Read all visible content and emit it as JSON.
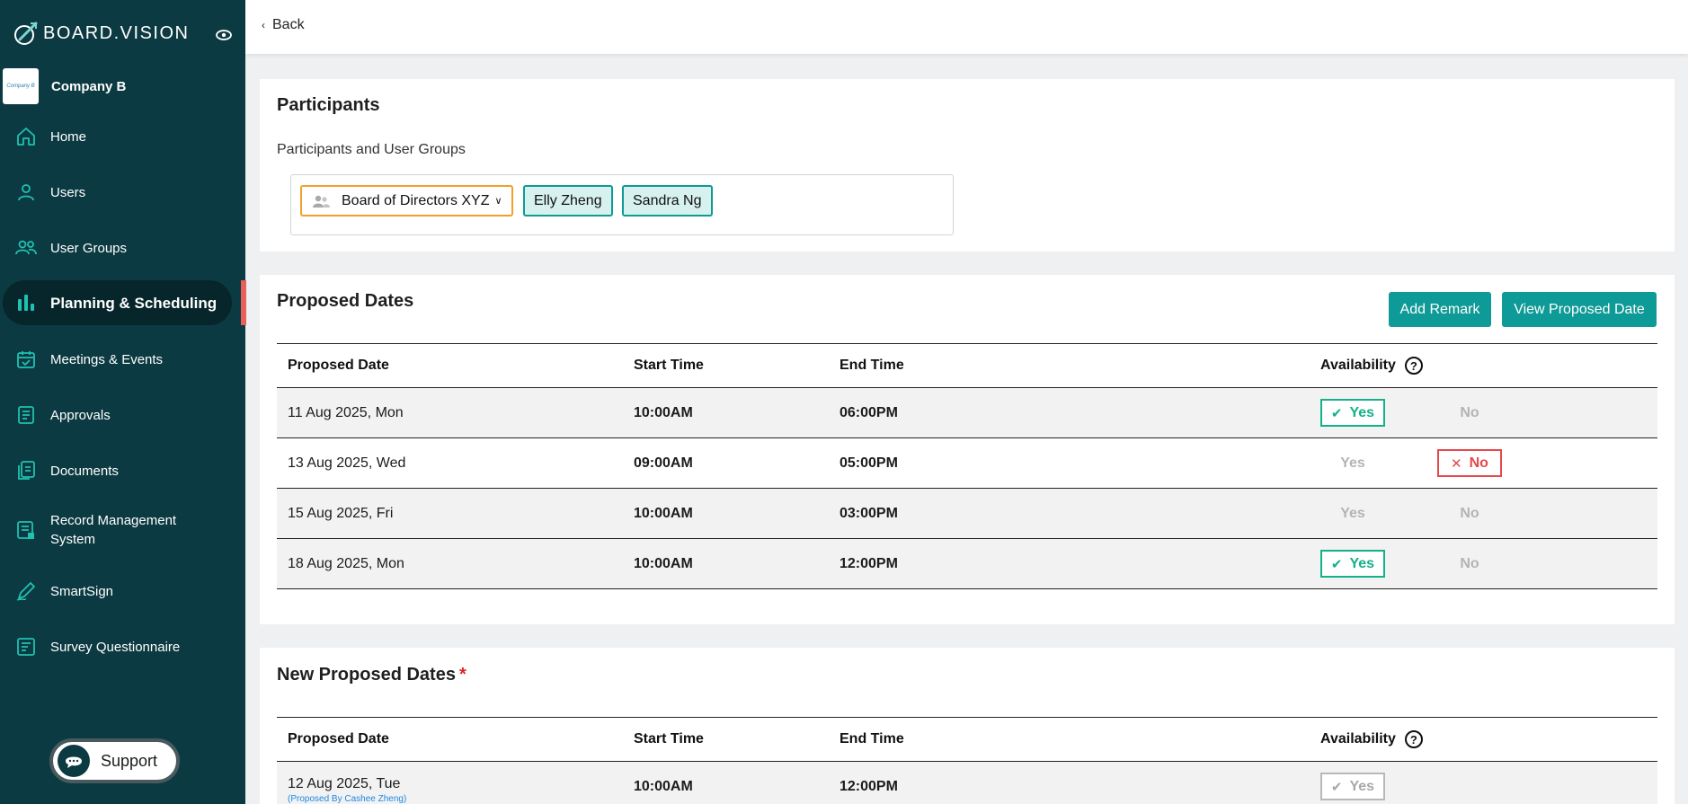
{
  "brand": {
    "name": "BOARD.VISION",
    "accent": "#0e9a96",
    "sidebar_bg": "#0c3a42"
  },
  "company": {
    "name": "Company B",
    "logo_text": "Company B"
  },
  "sidebar": {
    "items": [
      {
        "label": "Home",
        "icon": "home-icon"
      },
      {
        "label": "Users",
        "icon": "user-icon"
      },
      {
        "label": "User Groups",
        "icon": "users-icon"
      },
      {
        "label": "Planning & Scheduling",
        "icon": "chart-bars-icon",
        "active": true
      },
      {
        "label": "Meetings & Events",
        "icon": "calendar-check-icon"
      },
      {
        "label": "Approvals",
        "icon": "document-list-icon"
      },
      {
        "label": "Documents",
        "icon": "documents-icon"
      },
      {
        "label": "Record Management System",
        "icon": "records-icon"
      },
      {
        "label": "SmartSign",
        "icon": "pen-icon"
      },
      {
        "label": "Survey Questionnaire",
        "icon": "survey-icon"
      }
    ],
    "support_label": "Support"
  },
  "topbar": {
    "back_label": "Back"
  },
  "participants": {
    "title": "Participants",
    "label": "Participants and User Groups",
    "group_chip": "Board of Directors XYZ",
    "users": [
      "Elly Zheng",
      "Sandra Ng"
    ]
  },
  "proposed": {
    "title": "Proposed Dates",
    "add_remark_label": "Add Remark",
    "view_label": "View Proposed Date",
    "headers": {
      "date": "Proposed Date",
      "start": "Start Time",
      "end": "End Time",
      "availability": "Availability",
      "help": "?"
    },
    "yes_label": "Yes",
    "no_label": "No",
    "rows": [
      {
        "date": "11 Aug 2025, Mon",
        "start": "10:00AM",
        "end": "06:00PM",
        "availability": "yes"
      },
      {
        "date": "13 Aug 2025, Wed",
        "start": "09:00AM",
        "end": "05:00PM",
        "availability": "no"
      },
      {
        "date": "15 Aug 2025, Fri",
        "start": "10:00AM",
        "end": "03:00PM",
        "availability": "none"
      },
      {
        "date": "18 Aug 2025, Mon",
        "start": "10:00AM",
        "end": "12:00PM",
        "availability": "yes"
      }
    ]
  },
  "new_proposed": {
    "title": "New Proposed Dates",
    "required_mark": "*",
    "headers": {
      "date": "Proposed Date",
      "start": "Start Time",
      "end": "End Time",
      "availability": "Availability",
      "help": "?"
    },
    "rows": [
      {
        "date": "12 Aug 2025, Tue",
        "note": "(Proposed By Cashee Zheng)",
        "start": "10:00AM",
        "end": "12:00PM",
        "yes_label": "Yes"
      }
    ]
  }
}
